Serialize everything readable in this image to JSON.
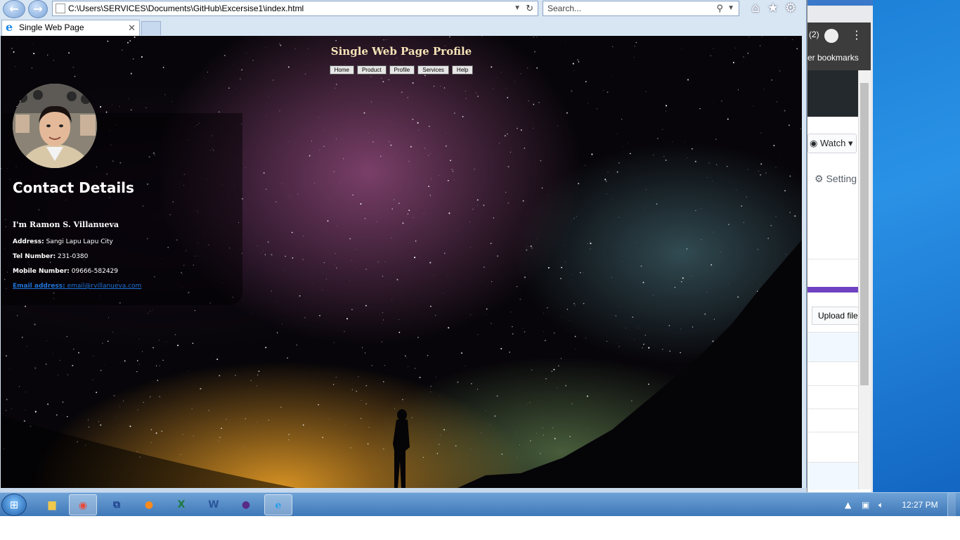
{
  "browser": {
    "address": "C:\\Users\\SERVICES\\Documents\\GitHub\\Excersise1\\index.html",
    "search_placeholder": "Search...",
    "tab_title": "Single Web Page"
  },
  "page": {
    "title": "Single Web Page Profile",
    "menu": [
      "Home",
      "Product",
      "Profile",
      "Services",
      "Help"
    ],
    "contact": {
      "heading": "Contact Details",
      "intro": "I'm Ramon S. Villanueva",
      "address_label": "Address:",
      "address_value": "Sangi Lapu Lapu City",
      "tel_label": "Tel Number:",
      "tel_value": "231-0380",
      "mobile_label": "Mobile Number:",
      "mobile_value": "09666-582429",
      "email_label": "Email address:",
      "email_value": "email@rvillanueva.com"
    }
  },
  "background_window": {
    "badge": "(2)",
    "bookmarks_text": "er bookmarks",
    "watch_label": "Watch",
    "settings_label": "Setting",
    "upload_label": "Upload file"
  },
  "taskbar": {
    "time": "12:27 PM",
    "apps": [
      "explorer-icon",
      "chrome-icon",
      "app-icon",
      "firefox-icon",
      "excel-icon",
      "word-icon",
      "app-icon-2",
      "ie-icon"
    ]
  }
}
